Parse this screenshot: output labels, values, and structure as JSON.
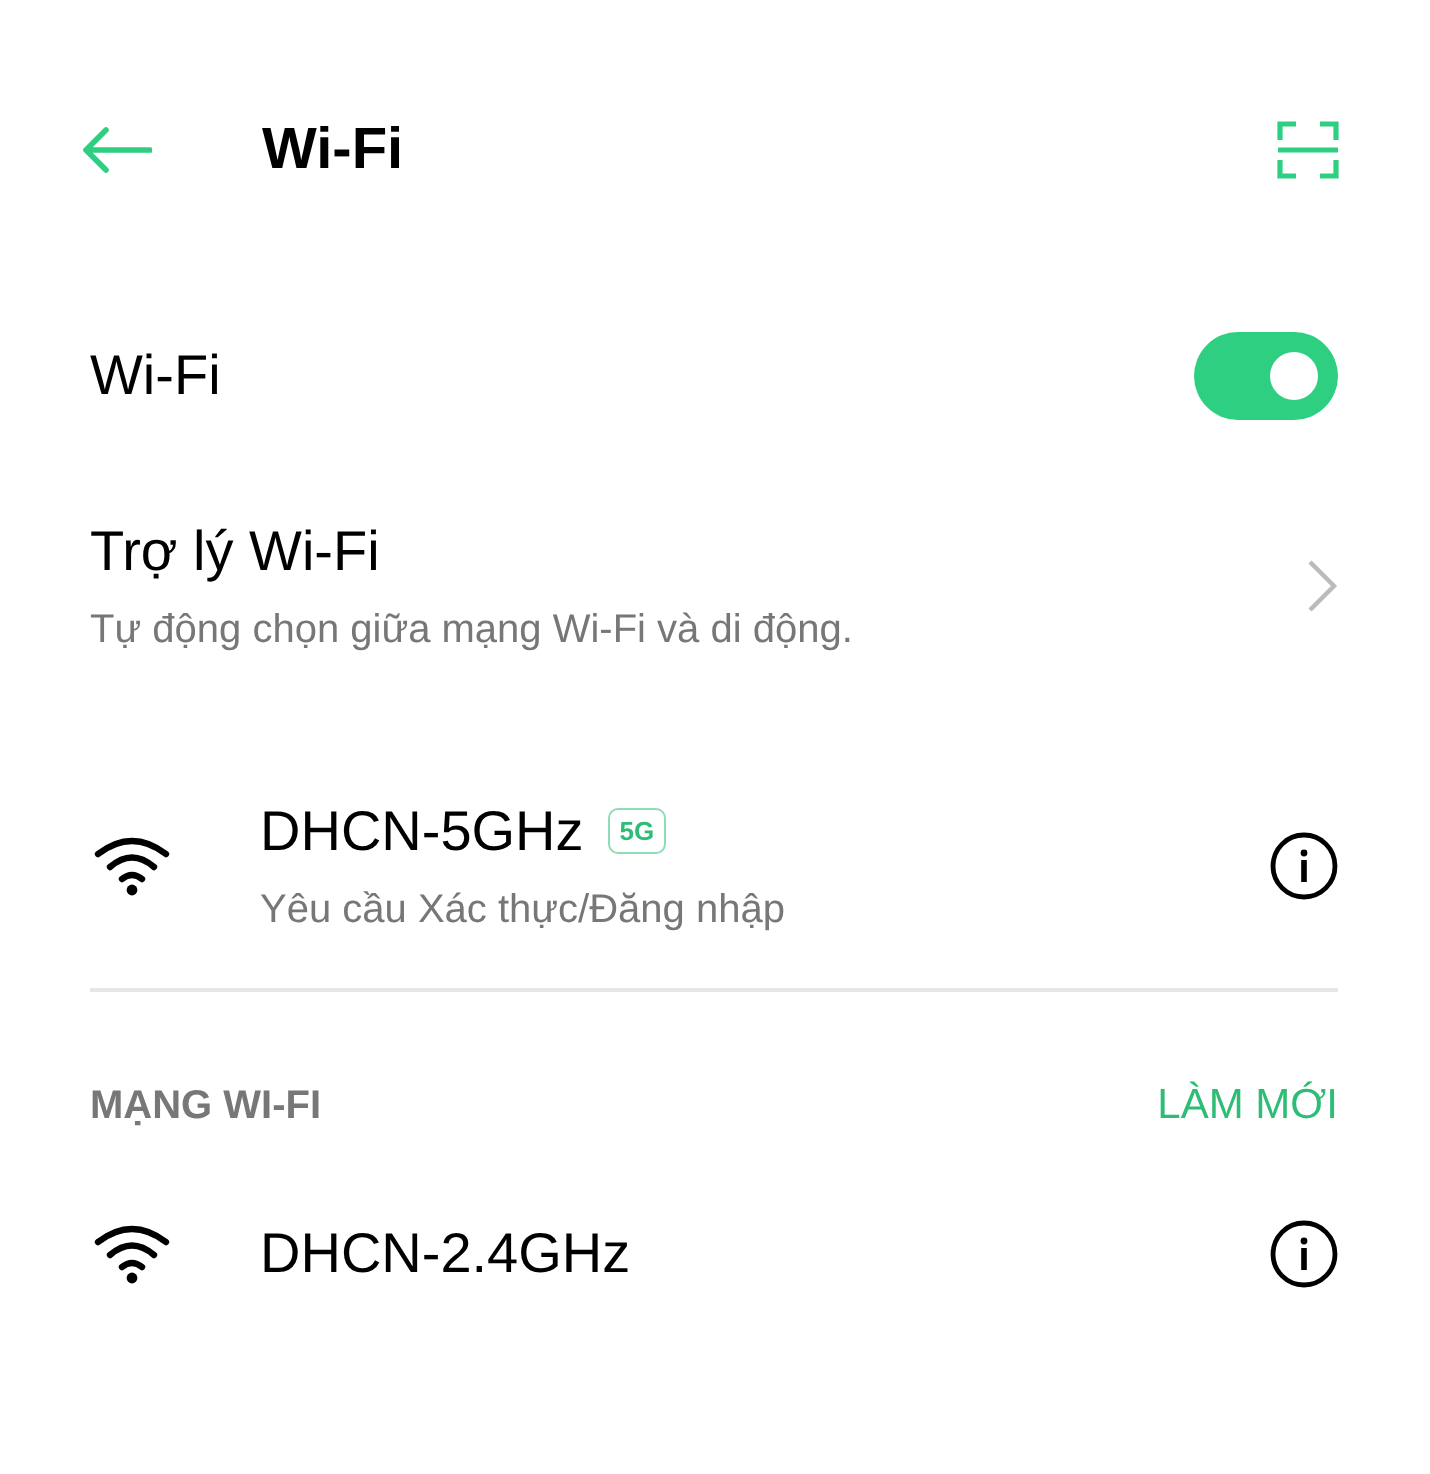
{
  "header": {
    "title": "Wi-Fi"
  },
  "wifi_toggle": {
    "label": "Wi-Fi",
    "on": true
  },
  "assistant": {
    "title": "Trợ lý Wi-Fi",
    "subtitle": "Tự động chọn giữa mạng Wi-Fi và di động."
  },
  "connected_network": {
    "name": "DHCN-5GHz",
    "badge": "5G",
    "status": "Yêu cầu Xác thực/Đăng nhập"
  },
  "section": {
    "title": "MẠNG WI-FI",
    "action": "LÀM MỚI"
  },
  "networks": [
    {
      "name": "DHCN-2.4GHz"
    }
  ]
}
